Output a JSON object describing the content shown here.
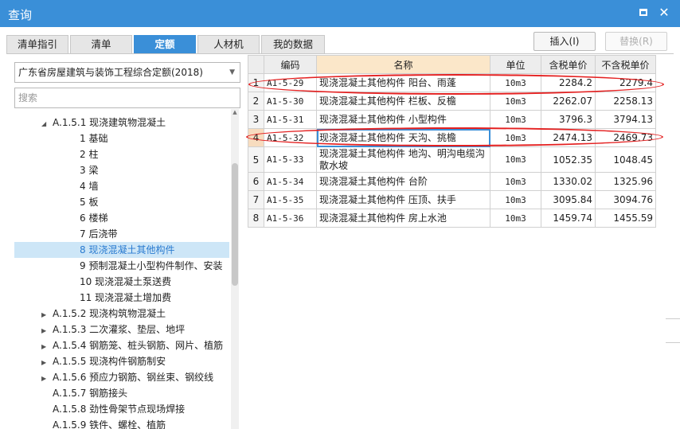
{
  "window": {
    "title": "查询"
  },
  "tabs": [
    "清单指引",
    "清单",
    "定额",
    "人材机",
    "我的数据"
  ],
  "buttons": {
    "insert": "插入(I)",
    "replace": "替换(R)"
  },
  "left": {
    "select_value": "广东省房屋建筑与装饰工程综合定额(2018)",
    "search_placeholder": "搜索",
    "tree": [
      {
        "label": "A.1.5.1 现浇建筑物混凝土",
        "level": 1,
        "expanded": true
      },
      {
        "label": "1 基础",
        "level": 2
      },
      {
        "label": "2 柱",
        "level": 2
      },
      {
        "label": "3 梁",
        "level": 2
      },
      {
        "label": "4 墙",
        "level": 2
      },
      {
        "label": "5 板",
        "level": 2
      },
      {
        "label": "6 楼梯",
        "level": 2
      },
      {
        "label": "7 后浇带",
        "level": 2
      },
      {
        "label": "8 现浇混凝土其他构件",
        "level": 2,
        "selected": true
      },
      {
        "label": "9 预制混凝土小型构件制作、安装",
        "level": 2
      },
      {
        "label": "10 现浇混凝土泵送费",
        "level": 2
      },
      {
        "label": "11 现浇混凝土增加费",
        "level": 2
      },
      {
        "label": "A.1.5.2 现浇构筑物混凝土",
        "level": 1,
        "expanded": false
      },
      {
        "label": "A.1.5.3 二次灌浆、垫层、地坪",
        "level": 1,
        "expanded": false
      },
      {
        "label": "A.1.5.4 钢筋笼、桩头钢筋、网片、植筋",
        "level": 1,
        "expanded": false
      },
      {
        "label": "A.1.5.5 现浇构件钢筋制安",
        "level": 1,
        "expanded": false
      },
      {
        "label": "A.1.5.6 预应力钢筋、钢丝束、钢绞线",
        "level": 1,
        "expanded": false
      },
      {
        "label": "A.1.5.7 钢筋接头",
        "level": 1
      },
      {
        "label": "A.1.5.8 劲性骨架节点现场焊接",
        "level": 1
      },
      {
        "label": "A.1.5.9 铁件、螺栓、植筋",
        "level": 1
      }
    ]
  },
  "table": {
    "headers": [
      "",
      "编码",
      "名称",
      "单位",
      "含税单价",
      "不含税单价"
    ],
    "rows": [
      {
        "idx": "1",
        "code": "A1-5-29",
        "name": "现浇混凝土其他构件 阳台、雨蓬",
        "unit": "10m3",
        "price_tax": "2284.2",
        "price_notax": "2279.4"
      },
      {
        "idx": "2",
        "code": "A1-5-30",
        "name": "现浇混凝土其他构件 栏板、反檐",
        "unit": "10m3",
        "price_tax": "2262.07",
        "price_notax": "2258.13"
      },
      {
        "idx": "3",
        "code": "A1-5-31",
        "name": "现浇混凝土其他构件 小型构件",
        "unit": "10m3",
        "price_tax": "3796.3",
        "price_notax": "3794.13"
      },
      {
        "idx": "4",
        "code": "A1-5-32",
        "name": "现浇混凝土其他构件 天沟、挑檐",
        "unit": "10m3",
        "price_tax": "2474.13",
        "price_notax": "2469.73",
        "selected": true
      },
      {
        "idx": "5",
        "code": "A1-5-33",
        "name": "现浇混凝土其他构件 地沟、明沟电缆沟散水坡",
        "unit": "10m3",
        "price_tax": "1052.35",
        "price_notax": "1048.45"
      },
      {
        "idx": "6",
        "code": "A1-5-34",
        "name": "现浇混凝土其他构件 台阶",
        "unit": "10m3",
        "price_tax": "1330.02",
        "price_notax": "1325.96"
      },
      {
        "idx": "7",
        "code": "A1-5-35",
        "name": "现浇混凝土其他构件 压顶、扶手",
        "unit": "10m3",
        "price_tax": "3095.84",
        "price_notax": "3094.76"
      },
      {
        "idx": "8",
        "code": "A1-5-36",
        "name": "现浇混凝土其他构件 房上水池",
        "unit": "10m3",
        "price_tax": "1459.74",
        "price_notax": "1455.59"
      }
    ]
  },
  "colors": {
    "accent": "#3a8fd8",
    "annotation": "#e42020",
    "selected_row": "#cde6f7"
  }
}
